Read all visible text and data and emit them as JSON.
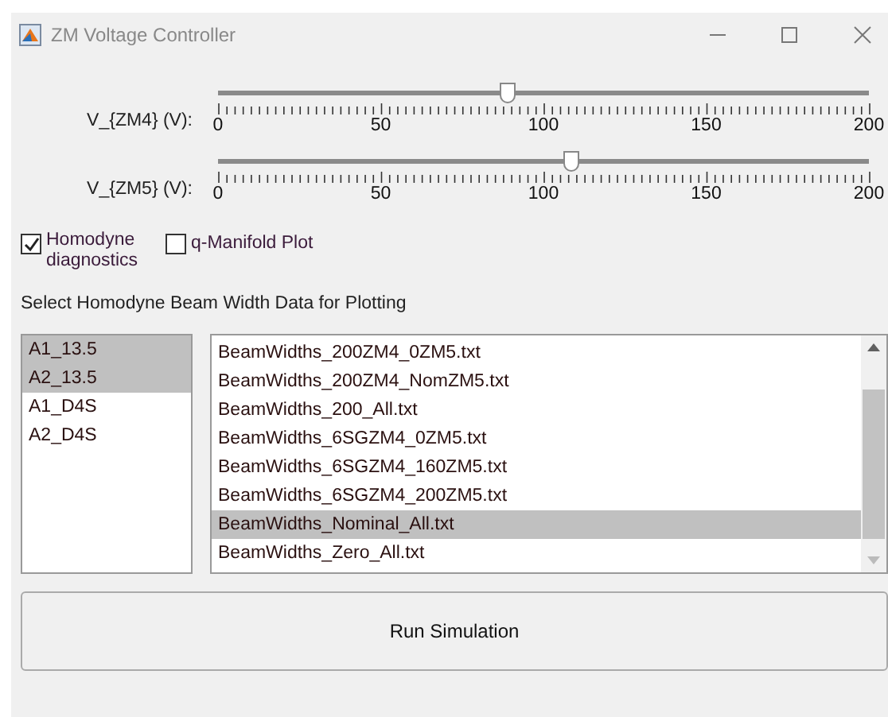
{
  "window": {
    "title": "ZM Voltage Controller"
  },
  "sliders": [
    {
      "label": "V_{ZM4} (V):",
      "level": 0.445,
      "ticks": [
        "0",
        "50",
        "100",
        "150",
        "200"
      ]
    },
    {
      "label": "V_{ZM5} (V):",
      "level": 0.543,
      "ticks": [
        "0",
        "50",
        "100",
        "150",
        "200"
      ]
    }
  ],
  "checkboxes": [
    {
      "label": "Homodyne diagnostics",
      "checked": true
    },
    {
      "label": "q-Manifold Plot",
      "checked": false
    }
  ],
  "heading": "Select Homodyne Beam Width Data for Plotting",
  "left_list": [
    {
      "label": "A1_13.5",
      "selected": true
    },
    {
      "label": "A2_13.5",
      "selected": true
    },
    {
      "label": "A1_D4S",
      "selected": false
    },
    {
      "label": "A2_D4S",
      "selected": false
    }
  ],
  "right_list": [
    {
      "label": "BeamWidths_200ZM4_0ZM5.txt",
      "selected": false
    },
    {
      "label": "BeamWidths_200ZM4_NomZM5.txt",
      "selected": false
    },
    {
      "label": "BeamWidths_200_All.txt",
      "selected": false
    },
    {
      "label": "BeamWidths_6SGZM4_0ZM5.txt",
      "selected": false
    },
    {
      "label": "BeamWidths_6SGZM4_160ZM5.txt",
      "selected": false
    },
    {
      "label": "BeamWidths_6SGZM4_200ZM5.txt",
      "selected": false
    },
    {
      "label": "BeamWidths_Nominal_All.txt",
      "selected": true
    },
    {
      "label": "BeamWidths_Zero_All.txt",
      "selected": false
    }
  ],
  "run_button": "Run Simulation"
}
